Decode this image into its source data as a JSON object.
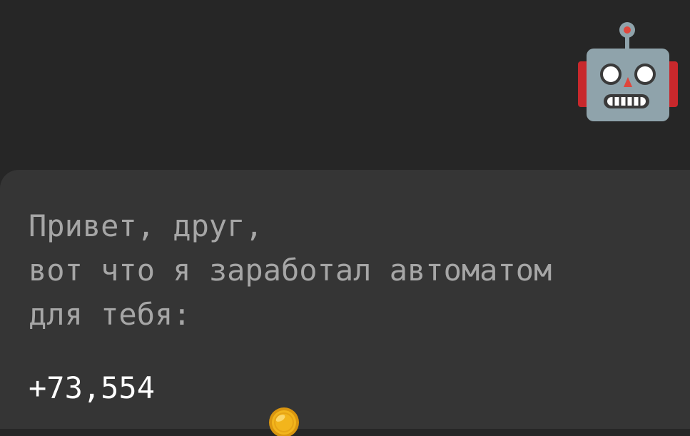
{
  "greeting": {
    "lines": [
      "Привет, друг,",
      "вот что я заработал автоматом",
      "для тебя:"
    ]
  },
  "reward": {
    "amount": "+73,554"
  },
  "icons": {
    "avatar": "robot-face-icon",
    "currency": "gold-coin-icon"
  },
  "colors": {
    "background": "#262626",
    "card": "#353535",
    "message_text": "#a6a6a6",
    "amount_text": "#ffffff",
    "coin": "#f2b51c"
  }
}
